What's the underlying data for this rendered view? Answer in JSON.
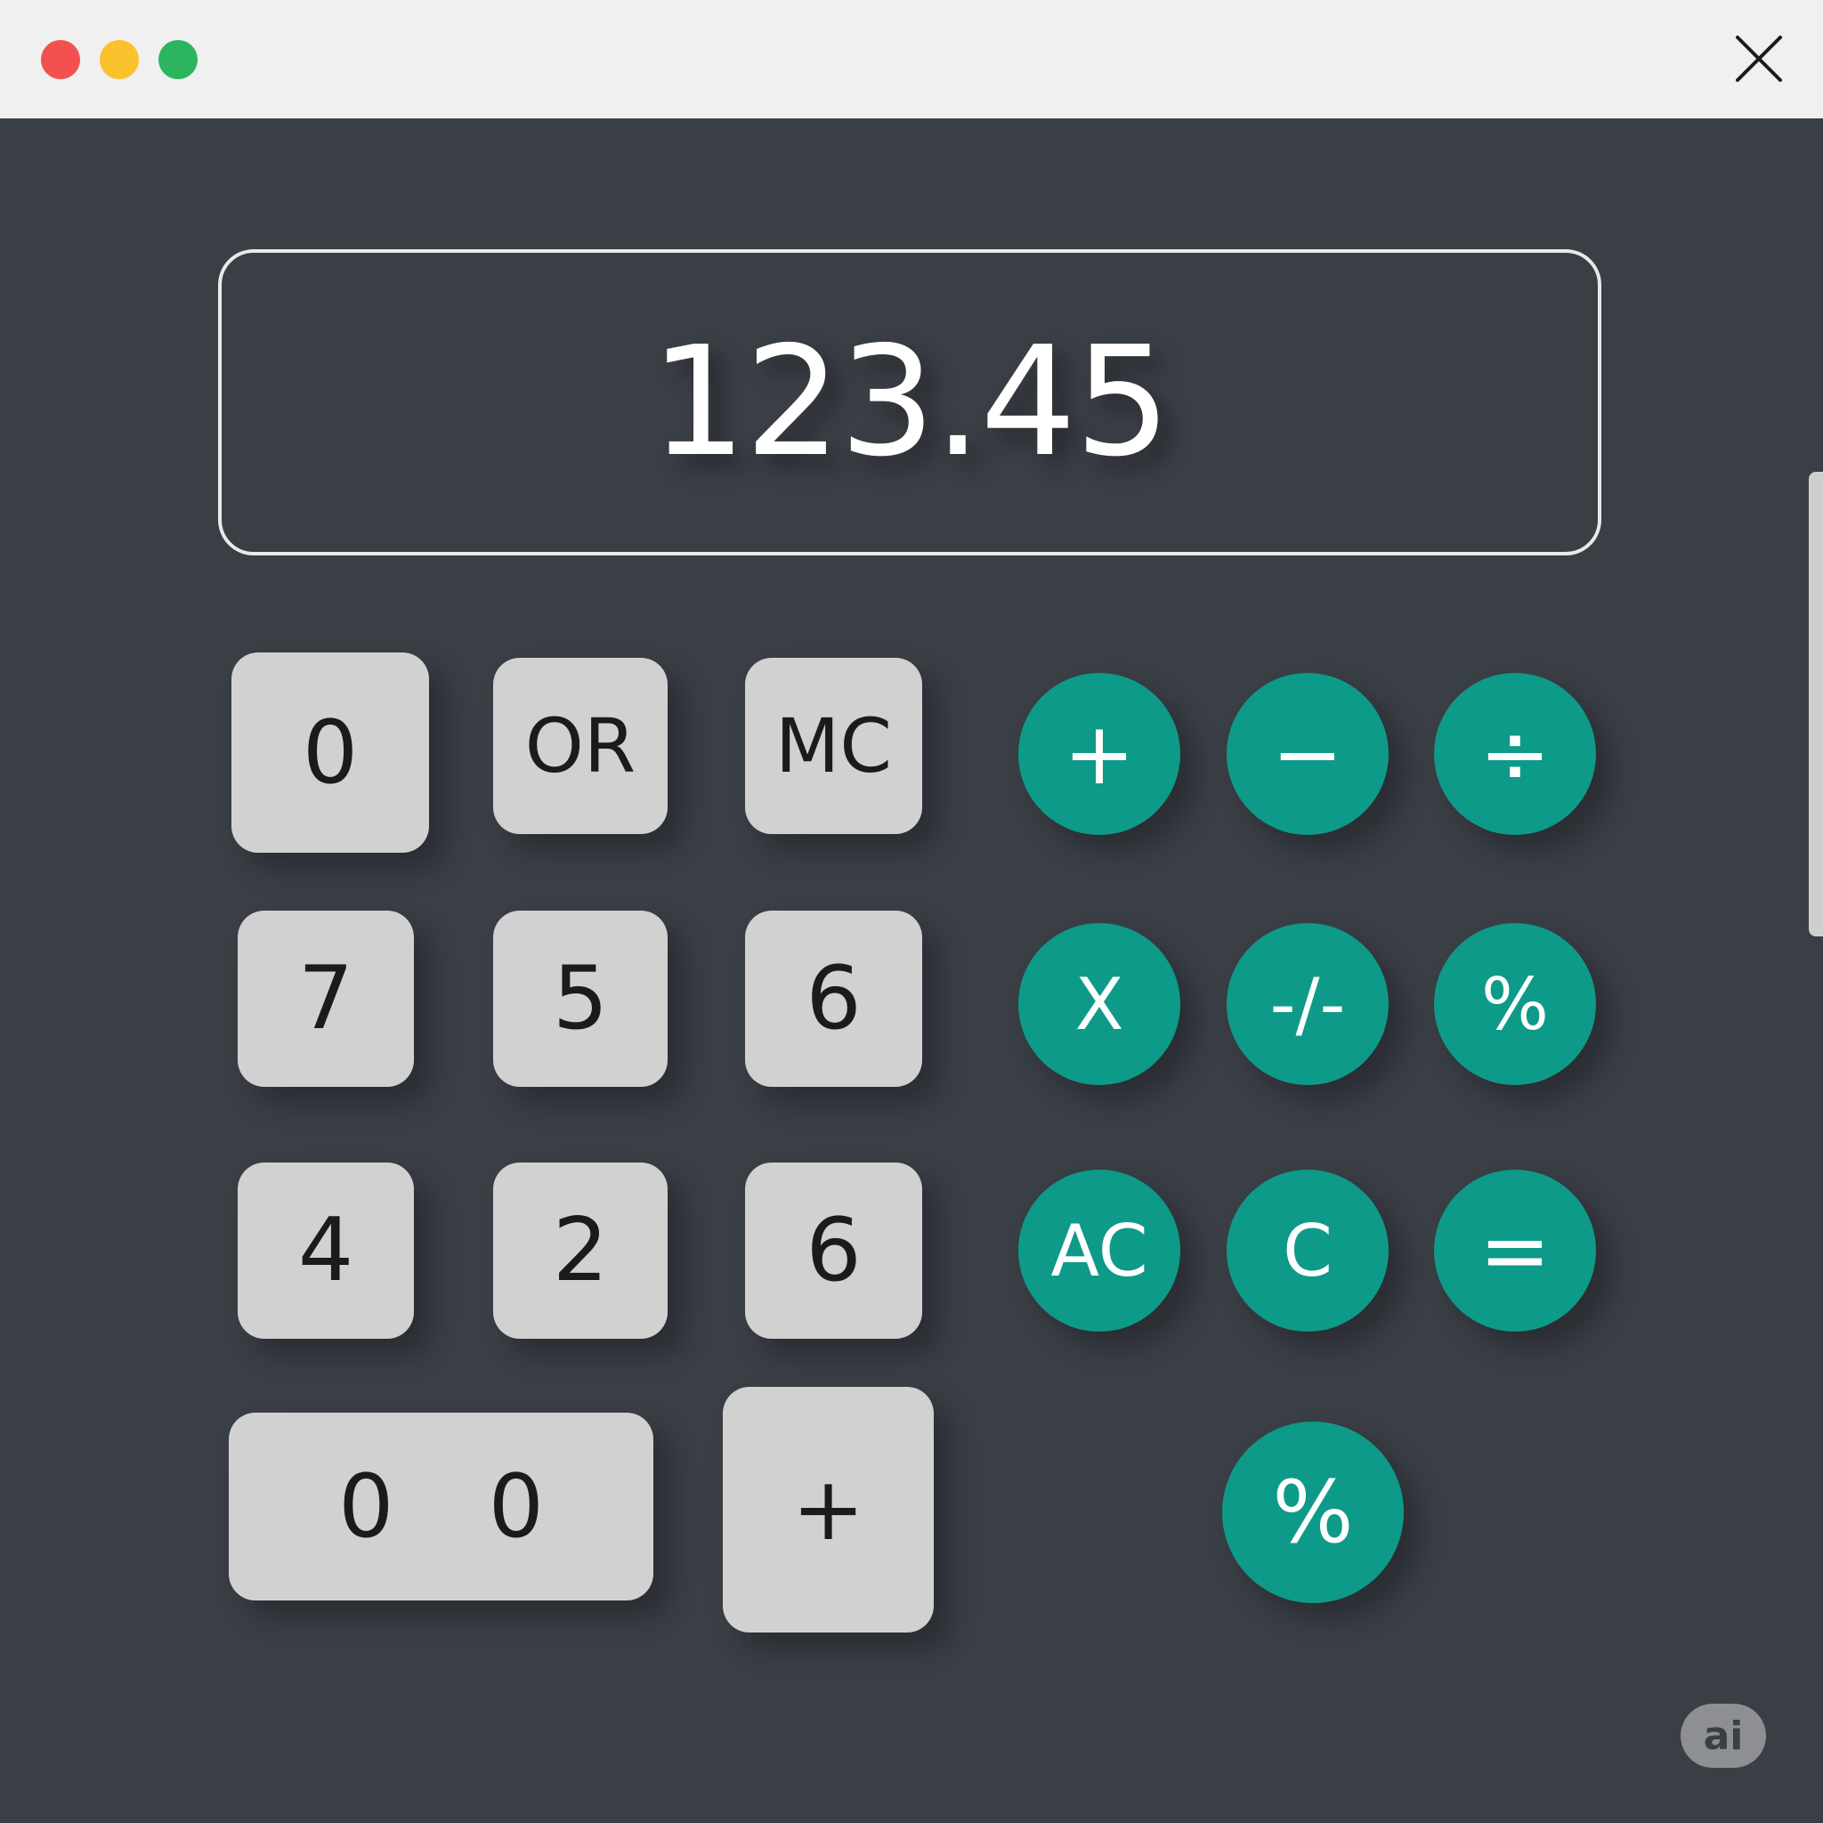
{
  "window": {
    "controls": {
      "close_color": "#f2514f",
      "minimize_color": "#fcc22d",
      "maximize_color": "#2db45f"
    },
    "close_icon": "close-x-icon"
  },
  "display": {
    "value": "123.45"
  },
  "keypad": {
    "row1": [
      "0",
      "OR",
      "MC"
    ],
    "row2": [
      "7",
      "5",
      "6"
    ],
    "row3": [
      "4",
      "2",
      "6"
    ],
    "row4_wide": [
      "0",
      "0"
    ],
    "row4_plus": "+"
  },
  "operators": {
    "row1": [
      "+",
      "−",
      "÷"
    ],
    "row2": [
      "X",
      "-/-",
      "%"
    ],
    "row3": [
      "AC",
      "C",
      "="
    ],
    "row4": [
      "%"
    ]
  },
  "badge": {
    "label": "ai"
  },
  "colors": {
    "background": "#3a3e45",
    "titlebar": "#f0f0f0",
    "key": "#d1d1d1",
    "operator": "#0e9a88"
  }
}
